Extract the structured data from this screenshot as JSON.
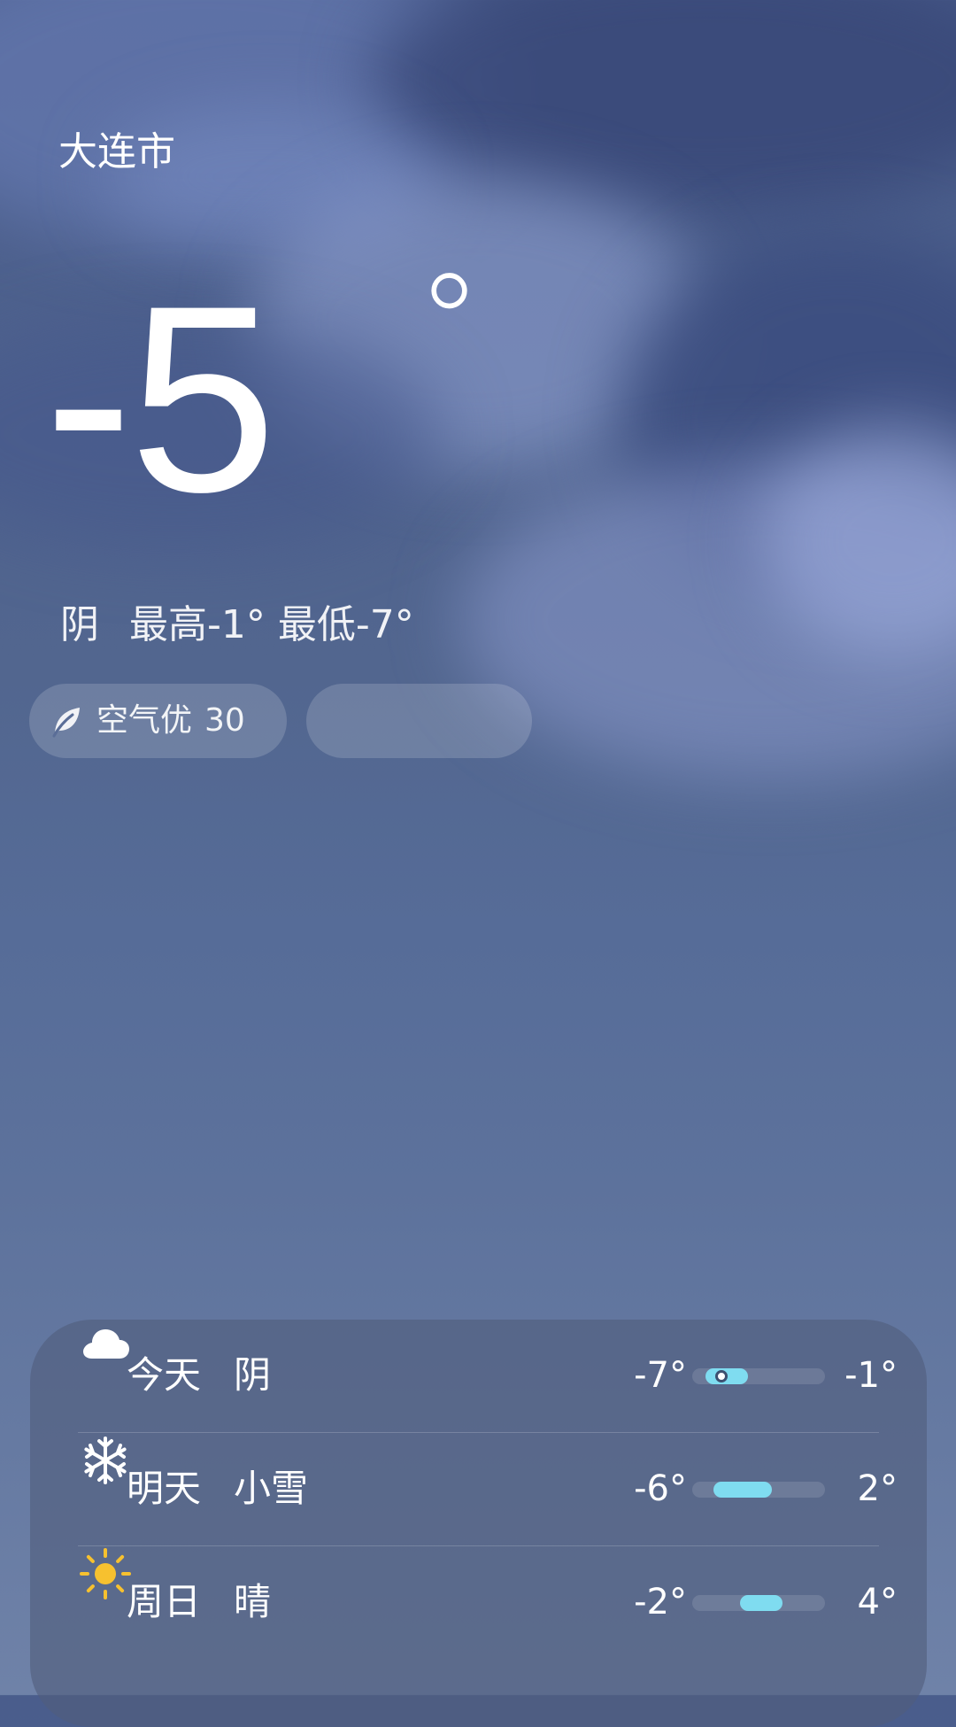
{
  "location": {
    "city": "大连市"
  },
  "current": {
    "temperature": "-5",
    "unit": "°",
    "condition": "阴",
    "high_label": "最高-1°",
    "low_label": "最低-7°"
  },
  "air_quality": {
    "label": "空气优",
    "value": "30",
    "icon": "leaf-icon"
  },
  "forecast": [
    {
      "day": "今天",
      "condition": "阴",
      "icon": "cloud-icon",
      "low": "-7°",
      "high": "-1°",
      "range_start": 0.1,
      "range_end": 0.42,
      "current_marker": 0.22
    },
    {
      "day": "明天",
      "condition": "小雪",
      "icon": "snowflake-icon",
      "low": "-6°",
      "high": "2°",
      "range_start": 0.16,
      "range_end": 0.6
    },
    {
      "day": "周日",
      "condition": "晴",
      "icon": "sun-icon",
      "low": "-2°",
      "high": "4°",
      "range_start": 0.36,
      "range_end": 0.68
    }
  ],
  "colors": {
    "range_fill": "#7fdcf0",
    "sun": "#f7c12f",
    "text": "#ffffff"
  }
}
